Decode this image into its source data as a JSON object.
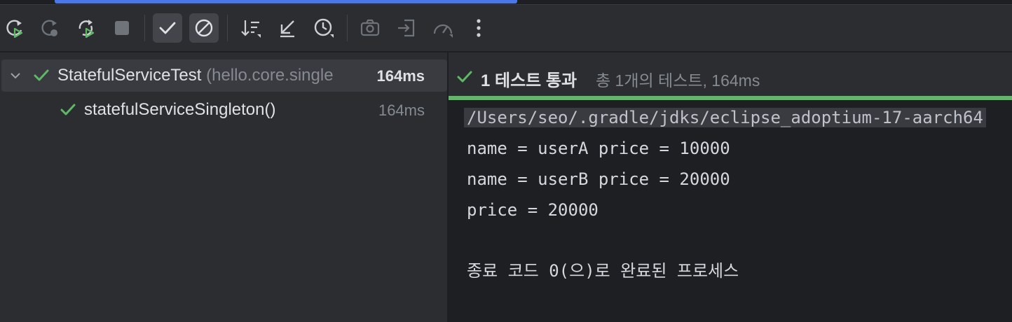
{
  "toolbar": {
    "buttons": [
      {
        "name": "rerun",
        "icon": "rerun-icon"
      },
      {
        "name": "rerun-failed",
        "icon": "rerun-failed-icon"
      },
      {
        "name": "toggle-auto-test",
        "icon": "auto-rerun-icon"
      },
      {
        "name": "stop",
        "icon": "stop-icon"
      },
      {
        "name": "show-passed",
        "icon": "check-icon",
        "active": true
      },
      {
        "name": "show-ignored",
        "icon": "ignored-icon",
        "active": true
      },
      {
        "name": "sort-alphabetically",
        "icon": "sort-alpha-icon"
      },
      {
        "name": "sort-by-duration",
        "icon": "collapse-icon"
      },
      {
        "name": "test-history",
        "icon": "history-icon"
      },
      {
        "name": "screenshot",
        "icon": "camera-icon"
      },
      {
        "name": "import-tests",
        "icon": "import-icon"
      },
      {
        "name": "coverage",
        "icon": "gauge-icon"
      },
      {
        "name": "more",
        "icon": "more-vertical-icon"
      }
    ]
  },
  "tree": {
    "root": {
      "name": "StatefulServiceTest",
      "package": "(hello.core.single",
      "duration": "164ms"
    },
    "child": {
      "name": "statefulServiceSingleton()",
      "duration": "164ms"
    }
  },
  "results": {
    "status_label": "1 테스트 통과",
    "summary": "총 1개의 테스트, 164ms"
  },
  "console": {
    "lines": [
      "/Users/seo/.gradle/jdks/eclipse_adoptium-17-aarch64",
      "name = userA price = 10000",
      "name = userB price = 20000",
      "price = 20000",
      "",
      "종료 코드 0(으)로 완료된 프로세스"
    ]
  },
  "colors": {
    "accent_blue": "#4a78e8",
    "success_green": "#5fb865",
    "panel": "#2b2d30",
    "editor": "#1e1f22"
  }
}
